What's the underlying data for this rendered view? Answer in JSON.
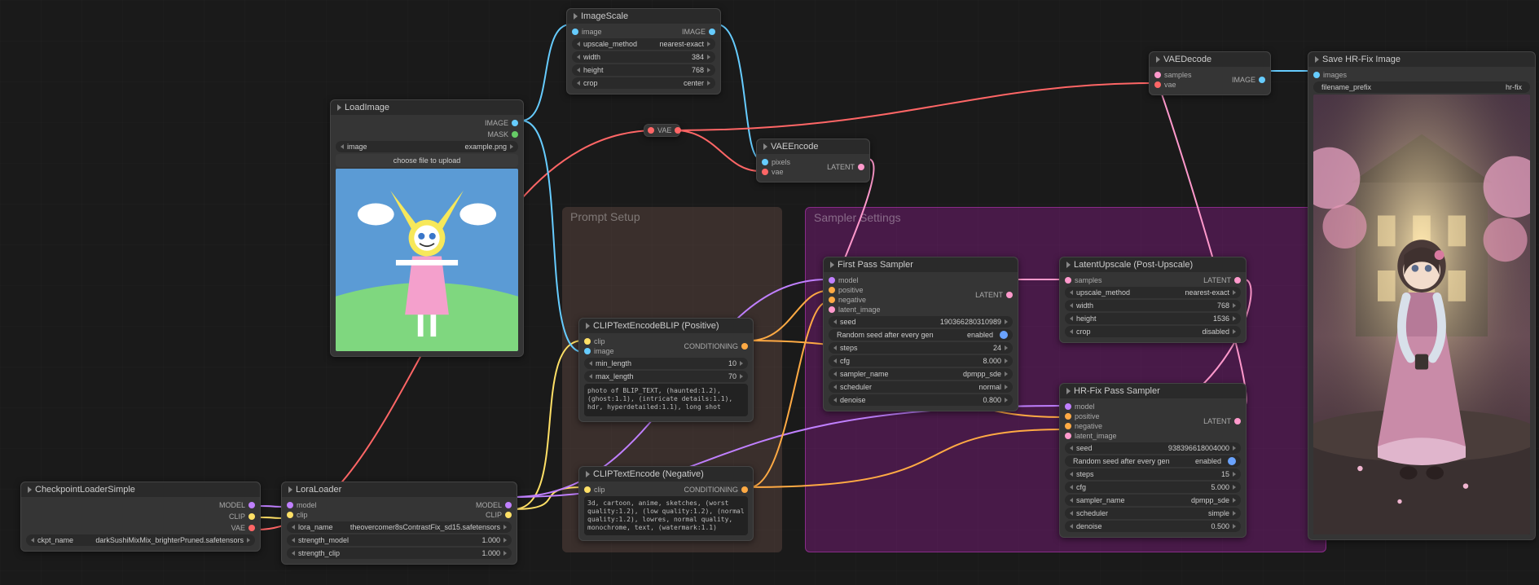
{
  "groups": {
    "prompt": "Prompt Setup",
    "sampler": "Sampler Settings"
  },
  "checkpoint": {
    "title": "CheckpointLoaderSimple",
    "out_model": "MODEL",
    "out_clip": "CLIP",
    "out_vae": "VAE",
    "ckpt_label": "ckpt_name",
    "ckpt_value": "darkSushiMixMix_brighterPruned.safetensors"
  },
  "lora": {
    "title": "LoraLoader",
    "in_model": "model",
    "in_clip": "clip",
    "out_model": "MODEL",
    "out_clip": "CLIP",
    "lora_name_label": "lora_name",
    "lora_name_value": "theovercomer8sContrastFix_sd15.safetensors",
    "strength_model_label": "strength_model",
    "strength_model_value": "1.000",
    "strength_clip_label": "strength_clip",
    "strength_clip_value": "1.000"
  },
  "load_image": {
    "title": "LoadImage",
    "out_image": "IMAGE",
    "out_mask": "MASK",
    "image_label": "image",
    "image_value": "example.png",
    "upload_button": "choose file to upload"
  },
  "image_scale": {
    "title": "ImageScale",
    "in_image": "image",
    "out_image": "IMAGE",
    "upscale_method_label": "upscale_method",
    "upscale_method_value": "nearest-exact",
    "width_label": "width",
    "width_value": "384",
    "height_label": "height",
    "height_value": "768",
    "crop_label": "crop",
    "crop_value": "center"
  },
  "vae_encode": {
    "title": "VAEEncode",
    "in_pixels": "pixels",
    "in_vae": "vae",
    "out_latent": "LATENT"
  },
  "vae_label": "VAE",
  "clip_positive": {
    "title": "CLIPTextEncodeBLIP (Positive)",
    "in_clip": "clip",
    "in_image": "image",
    "out_cond": "CONDITIONING",
    "min_length_label": "min_length",
    "min_length_value": "10",
    "max_length_label": "max_length",
    "max_length_value": "70",
    "text": "photo of BLIP_TEXT, (haunted:1.2), (ghost:1.1), (intricate details:1.1), hdr, hyperdetailed:1.1), long shot"
  },
  "clip_negative": {
    "title": "CLIPTextEncode (Negative)",
    "in_clip": "clip",
    "out_cond": "CONDITIONING",
    "text": "3d, cartoon, anime, sketches, (worst quality:1.2), (low quality:1.2), (normal quality:1.2), lowres, normal quality, monochrome, text, (watermark:1.1)"
  },
  "first_pass": {
    "title": "First Pass Sampler",
    "in_model": "model",
    "in_positive": "positive",
    "in_negative": "negative",
    "in_latent": "latent_image",
    "out_latent": "LATENT",
    "seed_label": "seed",
    "seed_value": "190366280310989",
    "rand_seed_label": "Random seed after every gen",
    "rand_seed_value": "enabled",
    "steps_label": "steps",
    "steps_value": "24",
    "cfg_label": "cfg",
    "cfg_value": "8.000",
    "sampler_label": "sampler_name",
    "sampler_value": "dpmpp_sde",
    "scheduler_label": "scheduler",
    "scheduler_value": "normal",
    "denoise_label": "denoise",
    "denoise_value": "0.800"
  },
  "latent_upscale": {
    "title": "LatentUpscale (Post-Upscale)",
    "in_samples": "samples",
    "out_latent": "LATENT",
    "upscale_method_label": "upscale_method",
    "upscale_method_value": "nearest-exact",
    "width_label": "width",
    "width_value": "768",
    "height_label": "height",
    "height_value": "1536",
    "crop_label": "crop",
    "crop_value": "disabled"
  },
  "hrfix": {
    "title": "HR-Fix Pass Sampler",
    "in_model": "model",
    "in_positive": "positive",
    "in_negative": "negative",
    "in_latent": "latent_image",
    "out_latent": "LATENT",
    "seed_label": "seed",
    "seed_value": "938396618004000",
    "rand_seed_label": "Random seed after every gen",
    "rand_seed_value": "enabled",
    "steps_label": "steps",
    "steps_value": "15",
    "cfg_label": "cfg",
    "cfg_value": "5.000",
    "sampler_label": "sampler_name",
    "sampler_value": "dpmpp_sde",
    "scheduler_label": "scheduler",
    "scheduler_value": "simple",
    "denoise_label": "denoise",
    "denoise_value": "0.500"
  },
  "vae_decode": {
    "title": "VAEDecode",
    "in_samples": "samples",
    "in_vae": "vae",
    "out_image": "IMAGE"
  },
  "save_image": {
    "title": "Save HR-Fix Image",
    "in_images": "images",
    "prefix_label": "filename_prefix",
    "prefix_value": "hr-fix"
  }
}
